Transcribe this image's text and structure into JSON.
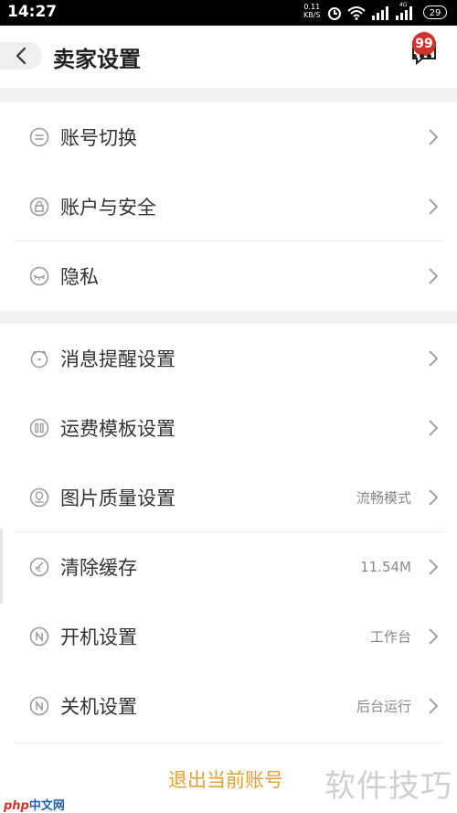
{
  "status_bar": {
    "time": "14:27",
    "net_speed_value": "0.11",
    "net_speed_unit": "KB/S",
    "network_label": "4G",
    "battery": "29"
  },
  "header": {
    "title": "卖家设置",
    "badge": "99"
  },
  "settings": {
    "items": [
      {
        "label": "账号切换",
        "value": "",
        "icon": "switch-icon"
      },
      {
        "label": "账户与安全",
        "value": "",
        "icon": "lock-icon"
      },
      {
        "label": "隐私",
        "value": "",
        "icon": "privacy-icon"
      },
      {
        "label": "消息提醒设置",
        "value": "",
        "icon": "bell-icon"
      },
      {
        "label": "运费模板设置",
        "value": "",
        "icon": "template-icon"
      },
      {
        "label": "图片质量设置",
        "value": "流畅模式",
        "icon": "image-quality-icon"
      },
      {
        "label": "清除缓存",
        "value": "11.54M",
        "icon": "broom-icon"
      },
      {
        "label": "开机设置",
        "value": "工作台",
        "icon": "power-on-icon"
      },
      {
        "label": "关机设置",
        "value": "后台运行",
        "icon": "power-off-icon"
      }
    ]
  },
  "logout": {
    "label": "退出当前账号"
  },
  "watermark": {
    "text": "软件技巧",
    "site_prefix": "php",
    "site_suffix": "中文网"
  },
  "colors": {
    "accent": "#e0a234",
    "badge": "#d0332e",
    "section_gap": "#f2f2f2"
  }
}
